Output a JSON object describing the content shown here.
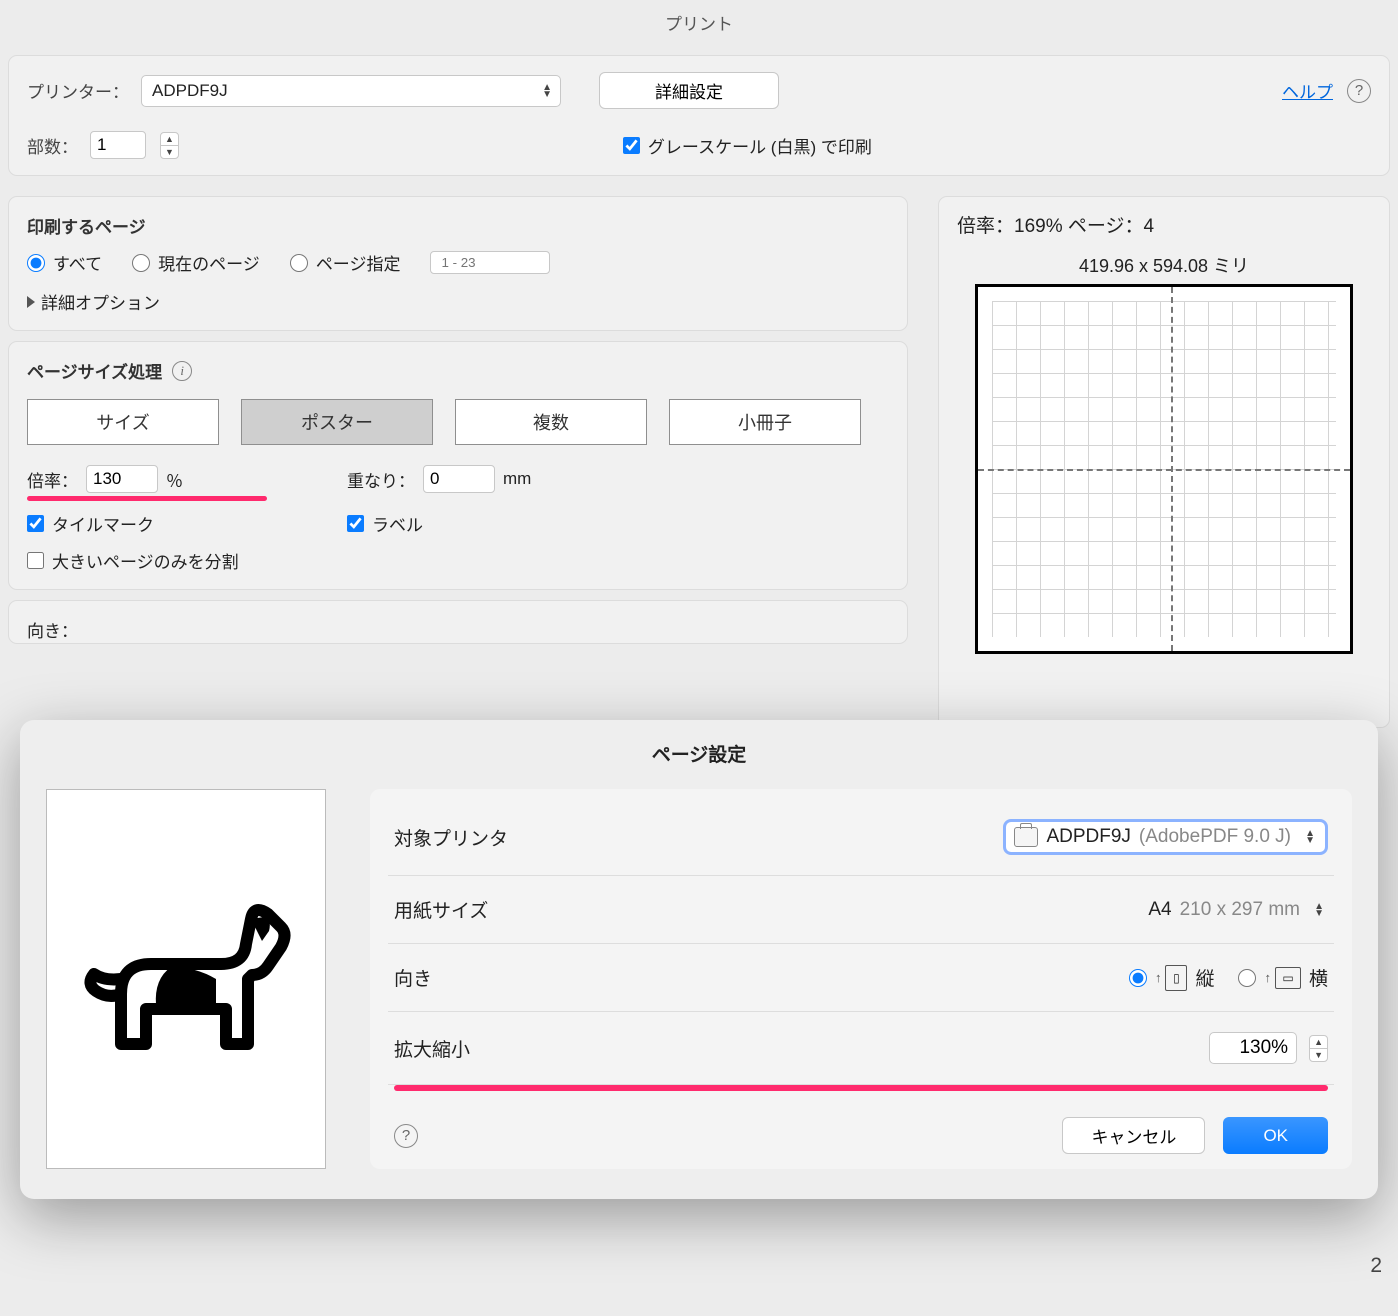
{
  "title": "プリント",
  "header": {
    "printer_label": "プリンター：",
    "printer_value": "ADPDF9J",
    "advanced_btn": "詳細設定",
    "help_link": "ヘルプ",
    "copies_label": "部数：",
    "copies_value": "1",
    "grayscale_label": "グレースケール (白黒) で印刷"
  },
  "pages": {
    "heading": "印刷するページ",
    "all": "すべて",
    "current": "現在のページ",
    "range": "ページ指定",
    "range_placeholder": "1 - 23",
    "more": "詳細オプション"
  },
  "sizing": {
    "heading": "ページサイズ処理",
    "tab_size": "サイズ",
    "tab_poster": "ポスター",
    "tab_multiple": "複数",
    "tab_booklet": "小冊子",
    "scale_label": "倍率：",
    "scale_value": "130",
    "scale_unit": "％",
    "overlap_label": "重なり：",
    "overlap_value": "0",
    "overlap_unit": "mm",
    "tilemark": "タイルマーク",
    "labels": "ラベル",
    "split": "大きいページのみを分割",
    "orientation_label": "向き："
  },
  "preview": {
    "summary_prefix": "倍率：",
    "summary_scale": "169%",
    "summary_mid": " ページ：",
    "summary_pages": "4",
    "dimensions": "419.96 x 594.08 ミリ"
  },
  "modal": {
    "title": "ページ設定",
    "target_label": "対象プリンタ",
    "target_value": "ADPDF9J",
    "target_detail": "(AdobePDF 9.0 J)",
    "paper_label": "用紙サイズ",
    "paper_value": "A4",
    "paper_detail": "210 x 297 mm",
    "orient_label": "向き",
    "orient_portrait": "縦",
    "orient_landscape": "横",
    "scale_label": "拡大縮小",
    "scale_value": "130%",
    "cancel": "キャンセル",
    "ok": "OK"
  },
  "behind_page_num": "2"
}
